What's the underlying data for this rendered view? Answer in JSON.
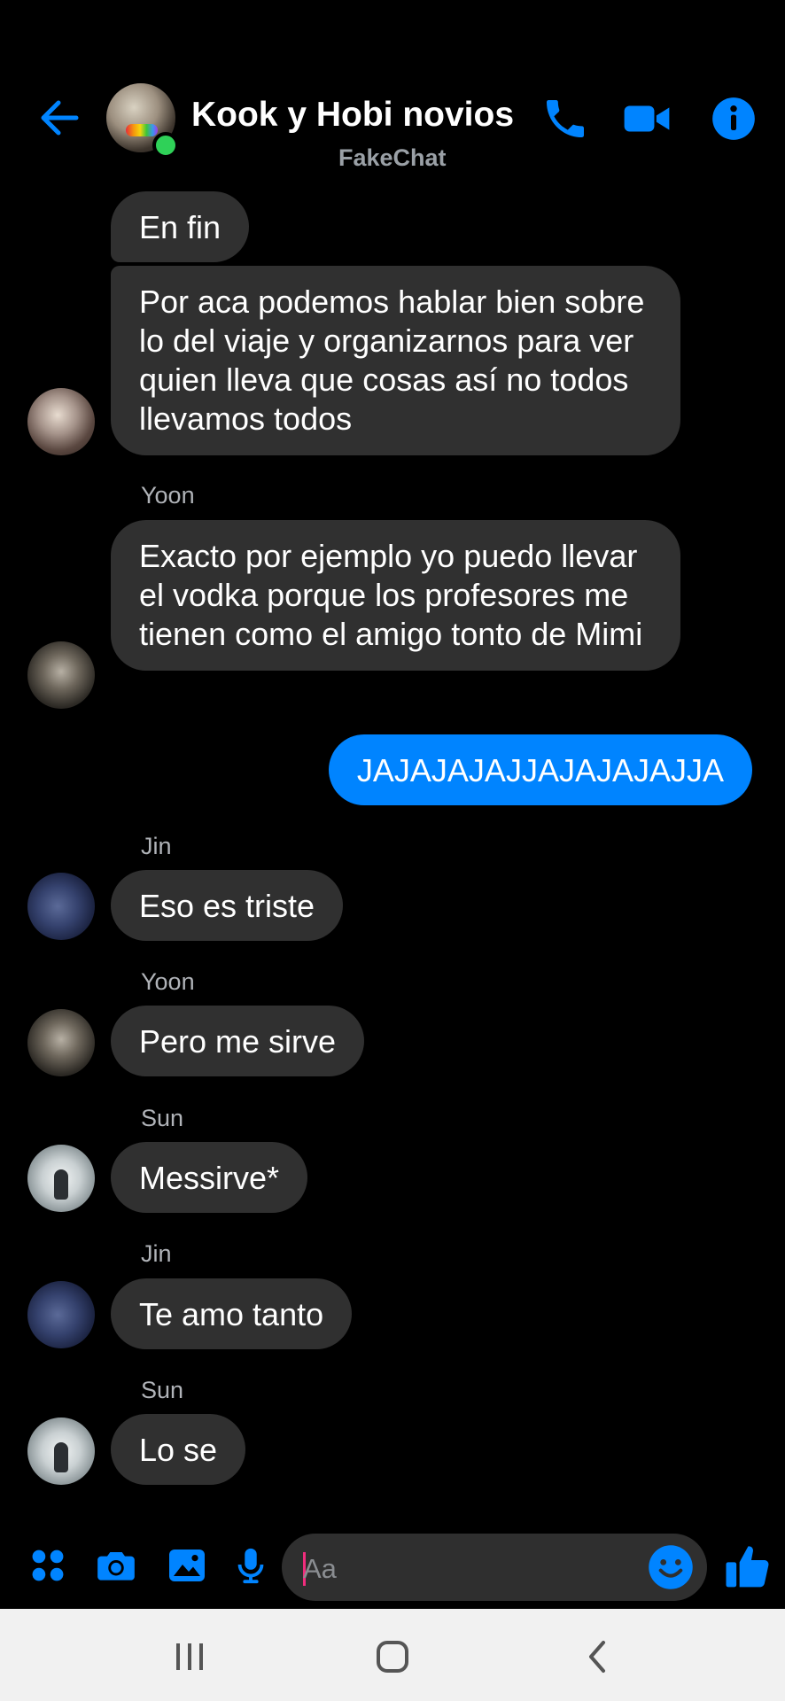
{
  "status": {
    "indicator": "⁷"
  },
  "header": {
    "title": "Kook y Hobi novios",
    "subtitle": "FakeChat",
    "back_icon": "arrow-left-icon",
    "call_icon": "phone-icon",
    "video_icon": "video-camera-icon",
    "info_icon": "info-icon",
    "accent_color": "#0084ff",
    "online_color": "#2fd158"
  },
  "messages": [
    {
      "sender": "",
      "text": "En fin",
      "mine": false
    },
    {
      "sender": "",
      "text": "Por aca podemos hablar bien sobre lo del viaje y organizarnos para ver quien lleva que cosas así no todos llevamos todos",
      "mine": false
    },
    {
      "sender": "Yoon",
      "text": "Exacto por ejemplo yo puedo llevar el vodka porque los profesores me tienen como el amigo tonto de Mimi",
      "mine": false
    },
    {
      "sender": "",
      "text": "JAJAJAJAJJAJAJAJAJJA",
      "mine": true
    },
    {
      "sender": "Jin",
      "text": "Eso es triste",
      "mine": false
    },
    {
      "sender": "Yoon",
      "text": "Pero me sirve",
      "mine": false
    },
    {
      "sender": "Sun",
      "text": "Messirve*",
      "mine": false
    },
    {
      "sender": "Jin",
      "text": "Te amo tanto",
      "mine": false
    },
    {
      "sender": "Sun",
      "text": "Lo se",
      "mine": false
    }
  ],
  "composer": {
    "placeholder": "Aa",
    "tools": [
      "apps-grid-icon",
      "camera-icon",
      "gallery-icon",
      "microphone-icon",
      "emoji-icon",
      "thumbs-up-icon"
    ]
  },
  "navigation": {
    "buttons": [
      "recent-apps-icon",
      "home-icon",
      "back-icon"
    ]
  },
  "colors": {
    "background": "#000000",
    "bubble_other": "#303030",
    "bubble_mine": "#0084ff",
    "nav_bar": "#f1f1f1"
  }
}
